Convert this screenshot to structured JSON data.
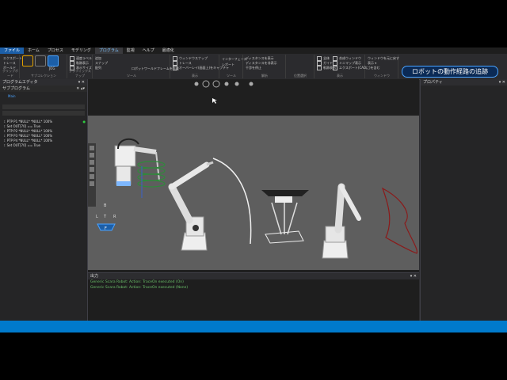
{
  "menu": [
    "ファイル",
    "ホーム",
    "プロセス",
    "モデリング",
    "プログラム",
    "監視",
    "ヘルプ",
    "最適化"
  ],
  "menu_active_index": 4,
  "ribbon": {
    "left_buttons": [
      "エクスポート",
      "トレース",
      "ボールド",
      "JOG",
      "追加",
      "スナップ",
      "配列"
    ],
    "options": [
      "速度ラベル",
      "軌跡表示",
      "表示サイズ",
      "再生スナップ"
    ],
    "group_labels": [
      "クリップボード",
      "サブコレクション",
      "グラフィックスナップ",
      "ツール",
      "表示",
      "ツール",
      "解析",
      "位置選択",
      "表示",
      "ウィンドウ"
    ],
    "frame_tool": "ロボットワールドフレームを作成",
    "view_checks": [
      "ウィンドウスナップ",
      "トレース",
      "オーバーレイ(画面上)をキャプチャ"
    ],
    "interference": [
      "インターフェース",
      "レポート"
    ],
    "collision": [
      "ディスタンスを表示",
      "ディスタンスを非表示",
      "干渉を停止"
    ],
    "misc_checks": [
      "全体",
      "ガイド",
      "軌跡表示",
      "合成ウィンドウ",
      "ミニマップ表示",
      "エクスポート(CADに)を含む"
    ],
    "window_buttons": [
      "ウィンドウを元に戻す",
      "表示 ▾"
    ]
  },
  "callout": "ロボットの動作経路の追跡",
  "program_editor": {
    "title": "プログラムエディタ",
    "sub_title": "サブプログラム",
    "tree_root": "Main",
    "lines": [
      "PTP P1 *NULL* *NULL* 100%",
      "Set OUT[70] == True",
      "PTP P2 *NULL* *NULL* 100%",
      "PTP P3 *NULL* *NULL* 100%",
      "PTP P4 *NULL* *NULL* 100%",
      "Set OUT[70] == True"
    ]
  },
  "properties": {
    "title": "プロパティ"
  },
  "output": {
    "title": "出力",
    "lines": [
      "Generic Scara Robot: Action: TraceOn executed (On)",
      "Generic Scara Robot: Action: TraceOn executed (None)"
    ]
  },
  "navcube": {
    "top": "B",
    "left": "L",
    "right": "R",
    "center": "T",
    "front": "F"
  },
  "colors": {
    "accent": "#1c5fa8",
    "trace_green": "#2e8b3a",
    "trace_red": "#8b1a1a",
    "output_text": "#6abf69"
  }
}
